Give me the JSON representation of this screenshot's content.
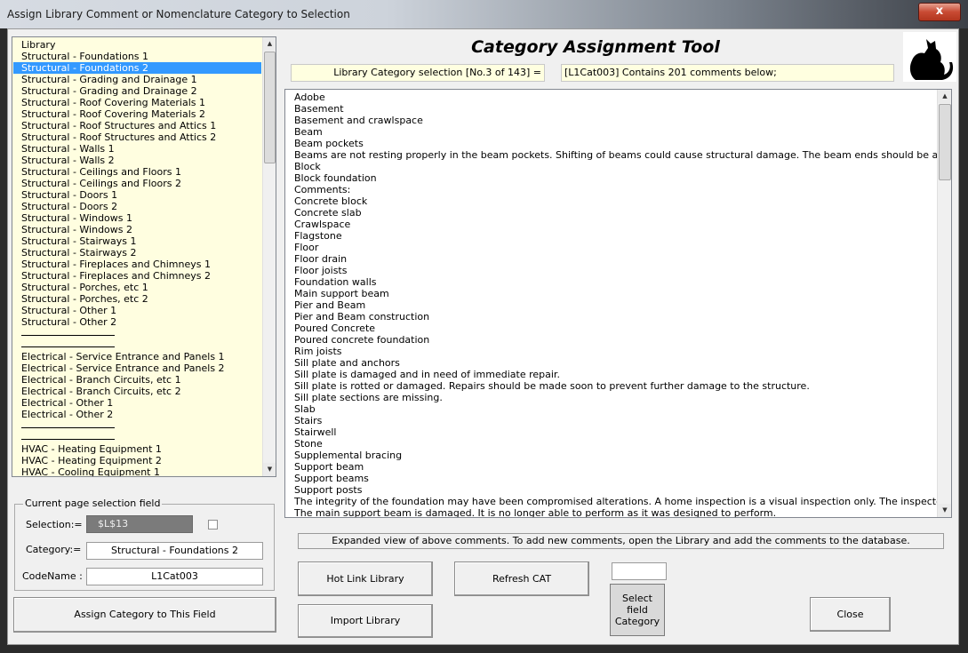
{
  "window": {
    "title": "Assign Library Comment or Nomenclature Category to Selection",
    "close_glyph": "x"
  },
  "library_list": {
    "items": [
      {
        "label": "Library",
        "type": "item"
      },
      {
        "label": "Structural - Foundations 1",
        "type": "item"
      },
      {
        "label": "Structural - Foundations 2",
        "type": "item",
        "selected": true
      },
      {
        "label": "Structural - Grading and Drainage 1",
        "type": "item"
      },
      {
        "label": "Structural - Grading and Drainage 2",
        "type": "item"
      },
      {
        "label": "Structural - Roof Covering Materials 1",
        "type": "item"
      },
      {
        "label": "Structural - Roof Covering Materials 2",
        "type": "item"
      },
      {
        "label": "Structural - Roof Structures and Attics 1",
        "type": "item"
      },
      {
        "label": "Structural - Roof Structures and Attics 2",
        "type": "item"
      },
      {
        "label": "Structural - Walls 1",
        "type": "item"
      },
      {
        "label": "Structural - Walls 2",
        "type": "item"
      },
      {
        "label": "Structural - Ceilings and Floors 1",
        "type": "item"
      },
      {
        "label": "Structural - Ceilings and Floors 2",
        "type": "item"
      },
      {
        "label": "Structural - Doors 1",
        "type": "item"
      },
      {
        "label": "Structural - Doors 2",
        "type": "item"
      },
      {
        "label": "Structural - Windows 1",
        "type": "item"
      },
      {
        "label": "Structural - Windows 2",
        "type": "item"
      },
      {
        "label": "Structural - Stairways 1",
        "type": "item"
      },
      {
        "label": "Structural - Stairways 2",
        "type": "item"
      },
      {
        "label": "Structural - Fireplaces and Chimneys 1",
        "type": "item"
      },
      {
        "label": "Structural - Fireplaces and Chimneys 2",
        "type": "item"
      },
      {
        "label": "Structural - Porches, etc 1",
        "type": "item"
      },
      {
        "label": "Structural - Porches, etc 2",
        "type": "item"
      },
      {
        "label": "Structural - Other 1",
        "type": "item"
      },
      {
        "label": "Structural - Other 2",
        "type": "item"
      },
      {
        "label": "",
        "type": "separator"
      },
      {
        "label": "",
        "type": "separator"
      },
      {
        "label": "Electrical - Service Entrance and Panels 1",
        "type": "item"
      },
      {
        "label": "Electrical - Service Entrance and Panels 2",
        "type": "item"
      },
      {
        "label": "Electrical - Branch Circuits, etc 1",
        "type": "item"
      },
      {
        "label": "Electrical - Branch Circuits, etc 2",
        "type": "item"
      },
      {
        "label": "Electrical - Other 1",
        "type": "item"
      },
      {
        "label": "Electrical - Other 2",
        "type": "item"
      },
      {
        "label": "",
        "type": "separator"
      },
      {
        "label": "",
        "type": "separator"
      },
      {
        "label": "HVAC - Heating Equipment 1",
        "type": "item"
      },
      {
        "label": "HVAC - Heating Equipment 2",
        "type": "item"
      },
      {
        "label": "HVAC - Cooling Equipment 1",
        "type": "item"
      }
    ]
  },
  "current_selection": {
    "group_label": "Current page selection field",
    "selection_label": "Selection:=",
    "selection_value": "$L$13",
    "category_label": "Category:=",
    "category_value": "Structural - Foundations 2",
    "codename_label": "CodeName :",
    "codename_value": "L1Cat003"
  },
  "assign_button": "Assign Category to This Field",
  "tool": {
    "title": "Category Assignment Tool",
    "selection_info": "Library Category selection [No.3 of 143]   =",
    "contains_info": "[L1Cat003] Contains 201 comments below;",
    "icon": "cat-logo-icon"
  },
  "comments": [
    "Adobe",
    "Basement",
    "Basement and crawlspace",
    "Beam",
    "Beam pockets",
    "Beams are not resting properly in the beam pockets.  Shifting of beams could cause structural damage.  The beam ends should be adjusted as needed",
    "Block",
    "Block foundation",
    "Comments:",
    "Concrete block",
    "Concrete slab",
    "Crawlspace",
    "Flagstone",
    "Floor",
    "Floor drain",
    "Floor joists",
    "Foundation walls",
    "Main support beam",
    "Pier and Beam",
    "Pier and Beam construction",
    "Poured Concrete",
    "Poured concrete foundation",
    "Rim joists",
    "Sill plate and anchors",
    "Sill plate is damaged and in need of immediate repair.",
    "Sill plate is rotted or damaged.  Repairs should be made soon to prevent further damage to the structure.",
    "Sill plate sections are missing.",
    "Slab",
    "Stairs",
    "Stairwell",
    "Stone",
    "Supplemental bracing",
    "Support beam",
    "Support beams",
    "Support posts",
    "The integrity of the foundation may have been compromised alterations. A home inspection is a visual inspection only. The inspector does not do engin",
    "The main support beam is damaged.  It is no longer able to perform as it was designed to perform."
  ],
  "expanded_note": "Expanded view of above comments. To add new comments, open the Library and add the comments to the database.",
  "buttons": {
    "hot_link": "Hot Link Library",
    "refresh": "Refresh CAT",
    "import": "Import Library",
    "select_field_1": "Select",
    "select_field_2": "field",
    "select_field_3": "Category",
    "close": "Close"
  },
  "small_input_value": ""
}
